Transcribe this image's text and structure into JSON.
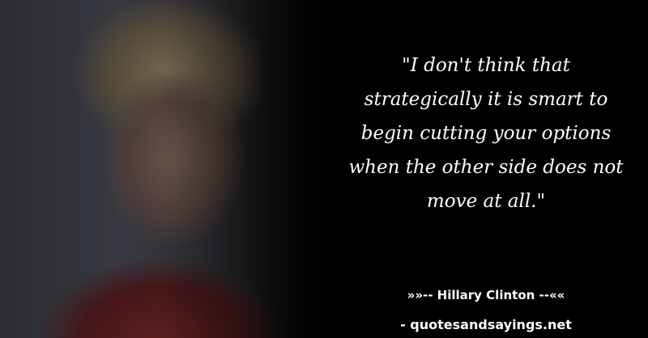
{
  "quote": {
    "lines": [
      "\"I don't think that",
      "strategically it is smart to",
      "begin cutting your options",
      "when the other side does not",
      "move at all.\""
    ]
  },
  "author": "»»-- Hillary Clinton --««",
  "site": "- quotesandsayings.net",
  "colors": {
    "background": "#000000",
    "text": "#ffffff"
  }
}
